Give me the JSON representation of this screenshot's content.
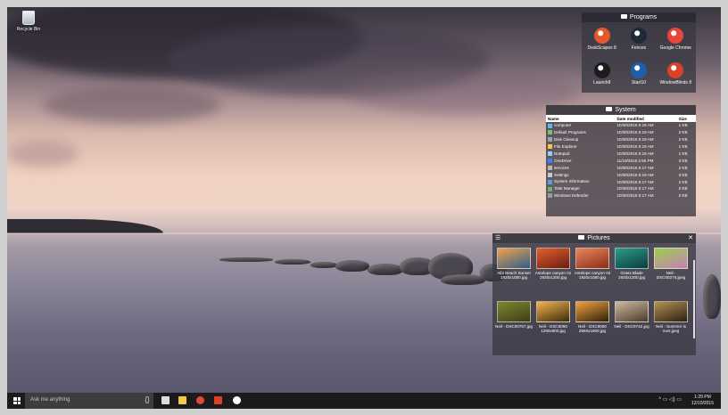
{
  "desktop_icons": [
    {
      "label": "Recycle Bin",
      "icon": "recycle-bin-icon"
    }
  ],
  "programs": {
    "title": "Programs",
    "items": [
      {
        "label": "DeskScapes 8",
        "icon": "deskscapes-icon",
        "color": "#e3592b"
      },
      {
        "label": "Fences",
        "icon": "fences-icon",
        "color": "#1f2937"
      },
      {
        "label": "Google Chrome",
        "icon": "chrome-icon",
        "color": "#e8453c"
      },
      {
        "label": "Launch8",
        "icon": "launch8-icon",
        "color": "#1c1c1c"
      },
      {
        "label": "Start10",
        "icon": "start10-icon",
        "color": "#1d5fad"
      },
      {
        "label": "WindowBlinds 8",
        "icon": "windowblinds-icon",
        "color": "#d84227"
      }
    ]
  },
  "system": {
    "title": "System",
    "columns": [
      "Name",
      "Date modified",
      "Size"
    ],
    "rows": [
      {
        "name": "computer",
        "date": "10/30/2015 5:18 AM",
        "size": "1 KB",
        "color": "#6fb0f0"
      },
      {
        "name": "Default Programs",
        "date": "10/30/2015 5:19 AM",
        "size": "2 KB",
        "color": "#7ac36a"
      },
      {
        "name": "Disk Cleanup",
        "date": "10/30/2015 5:19 AM",
        "size": "2 KB",
        "color": "#9aa4b0"
      },
      {
        "name": "File Explorer",
        "date": "10/30/2015 5:18 AM",
        "size": "1 KB",
        "color": "#f2c94c"
      },
      {
        "name": "Notepad",
        "date": "10/30/2015 5:18 AM",
        "size": "1 KB",
        "color": "#8fd0f5"
      },
      {
        "name": "OneDrive",
        "date": "11/19/2015 2:55 PM",
        "size": "3 KB",
        "color": "#3b82f6"
      },
      {
        "name": "services",
        "date": "10/30/2015 5:17 AM",
        "size": "2 KB",
        "color": "#b7b7b7"
      },
      {
        "name": "Settings",
        "date": "10/30/2015 5:19 AM",
        "size": "3 KB",
        "color": "#c9c9c9"
      },
      {
        "name": "System Information",
        "date": "10/30/2015 5:17 AM",
        "size": "2 KB",
        "color": "#5aa0e0"
      },
      {
        "name": "Task Manager",
        "date": "10/30/2015 5:17 AM",
        "size": "2 KB",
        "color": "#66b36b"
      },
      {
        "name": "Windows Defender",
        "date": "10/30/2015 5:17 AM",
        "size": "2 KB",
        "color": "#9a9a9a"
      }
    ]
  },
  "pictures": {
    "title": "Pictures",
    "items": [
      {
        "label": "Aibi Beach Sunset 1920x1080.jpg",
        "colors": [
          "#f0a24b",
          "#2e5d8e"
        ]
      },
      {
        "label": "Antelope canyon 01 1920x1200.jpg",
        "colors": [
          "#e2612c",
          "#6a1c14"
        ]
      },
      {
        "label": "Antelope canyon 04 1920x1080.jpg",
        "colors": [
          "#e9875a",
          "#8a2d1b"
        ]
      },
      {
        "label": "Grass Blade 1920x1200.jpg",
        "colors": [
          "#2c9c88",
          "#0d3b3f"
        ]
      },
      {
        "label": "Neil - DSC00275.jpeg",
        "colors": [
          "#9ccf4f",
          "#c67fb8"
        ]
      },
      {
        "label": "Neil - DSC00757.jpg",
        "colors": [
          "#7c8a2e",
          "#3f3b1a"
        ]
      },
      {
        "label": "Neil - DSC8050 1280x800.jpg",
        "colors": [
          "#f5b34a",
          "#3a2a10"
        ]
      },
      {
        "label": "Neil - DSC8050 2560x1600.jpg",
        "colors": [
          "#f1a23c",
          "#2d200c"
        ]
      },
      {
        "label": "Neil - DSC9742.jpg",
        "colors": [
          "#cdbb9c",
          "#4a3a2c"
        ]
      },
      {
        "label": "Neil - Summer is over.jpeg",
        "colors": [
          "#b6904e",
          "#2a2016"
        ]
      }
    ]
  },
  "taskbar": {
    "search_placeholder": "Ask me anything",
    "pinned": [
      {
        "icon": "task-view-icon",
        "color": "#dddddd"
      },
      {
        "icon": "file-explorer-icon",
        "color": "#f2c94c"
      },
      {
        "icon": "chrome-icon",
        "color": "#e8453c"
      },
      {
        "icon": "windowblinds-icon",
        "color": "#d84227"
      },
      {
        "icon": "settings-icon",
        "color": "#ffffff"
      }
    ],
    "tray_glyphs": "^ ▭ ◁) ▭",
    "time": "1:29 PM",
    "date": "12/10/2015"
  }
}
